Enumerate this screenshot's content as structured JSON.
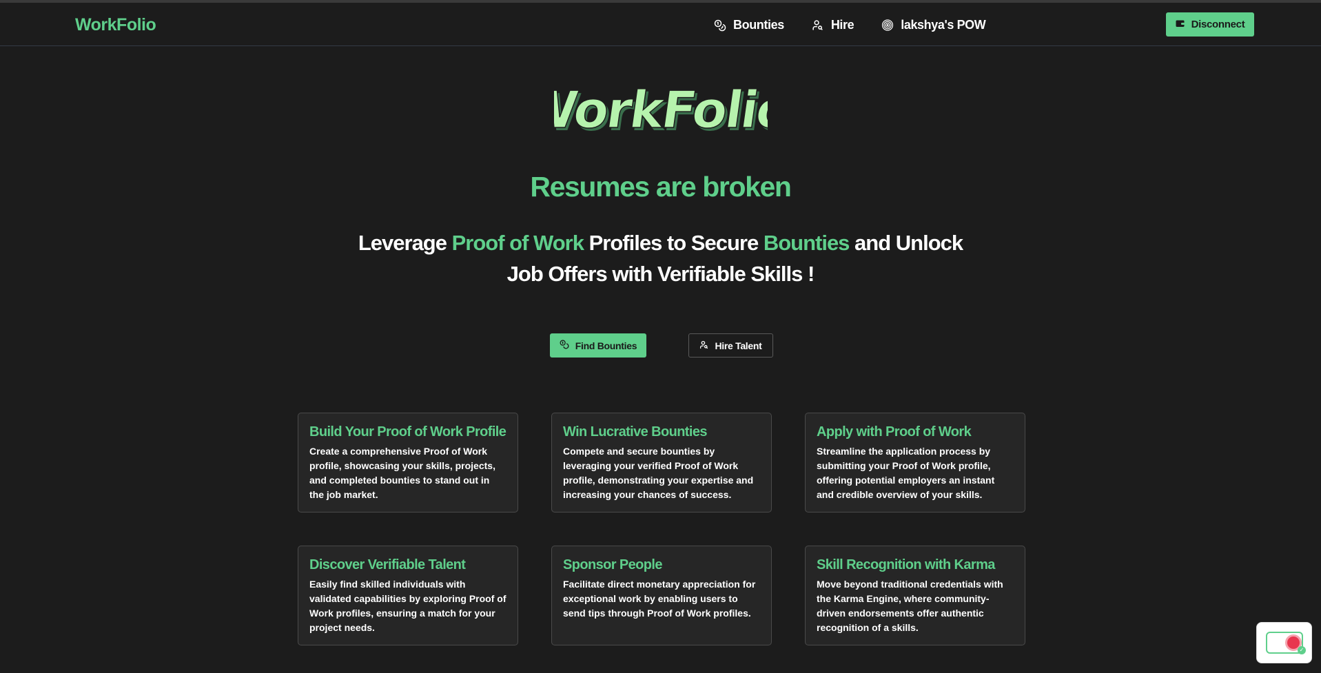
{
  "nav": {
    "brand": "WorkFolio",
    "links": [
      {
        "label": "Bounties",
        "icon": "coins-icon"
      },
      {
        "label": "Hire",
        "icon": "user-search-icon"
      },
      {
        "label": "lakshya's POW",
        "icon": "fingerprint-icon"
      }
    ],
    "disconnect_label": "Disconnect"
  },
  "hero": {
    "logo_text": "WorkFolio",
    "tagline": "Resumes are broken",
    "subline_parts": [
      "Leverage ",
      "Proof of Work",
      " Profiles to Secure ",
      "Bounties",
      " and Unlock Job Offers with Verifiable Skills !"
    ]
  },
  "cta": {
    "primary": "Find Bounties",
    "secondary": "Hire Talent"
  },
  "features": [
    {
      "title": "Build Your Proof of Work Profile",
      "body": "Create a comprehensive Proof of Work profile, showcasing your skills, projects, and completed bounties to stand out in the job market."
    },
    {
      "title": "Win Lucrative Bounties",
      "body": "Compete and secure bounties by leveraging your verified Proof of Work profile, demonstrating your expertise and increasing your chances of success."
    },
    {
      "title": "Apply with Proof of Work",
      "body": "Streamline the application process by submitting your Proof of Work profile, offering potential employers an instant and credible overview of your skills."
    },
    {
      "title": "Discover Verifiable Talent",
      "body": "Easily find skilled individuals with validated capabilities by exploring Proof of Work profiles, ensuring a match for your project needs."
    },
    {
      "title": "Sponsor People",
      "body": "Facilitate direct monetary appreciation for exceptional work by enabling users to send tips through Proof of Work profiles."
    },
    {
      "title": "Skill Recognition with Karma",
      "body": "Move beyond traditional credentials with the Karma Engine, where community-driven endorsements offer authentic recognition of a skills."
    }
  ],
  "colors": {
    "accent": "#5fcf8b",
    "background": "#1c1c1c",
    "card": "#262626"
  }
}
